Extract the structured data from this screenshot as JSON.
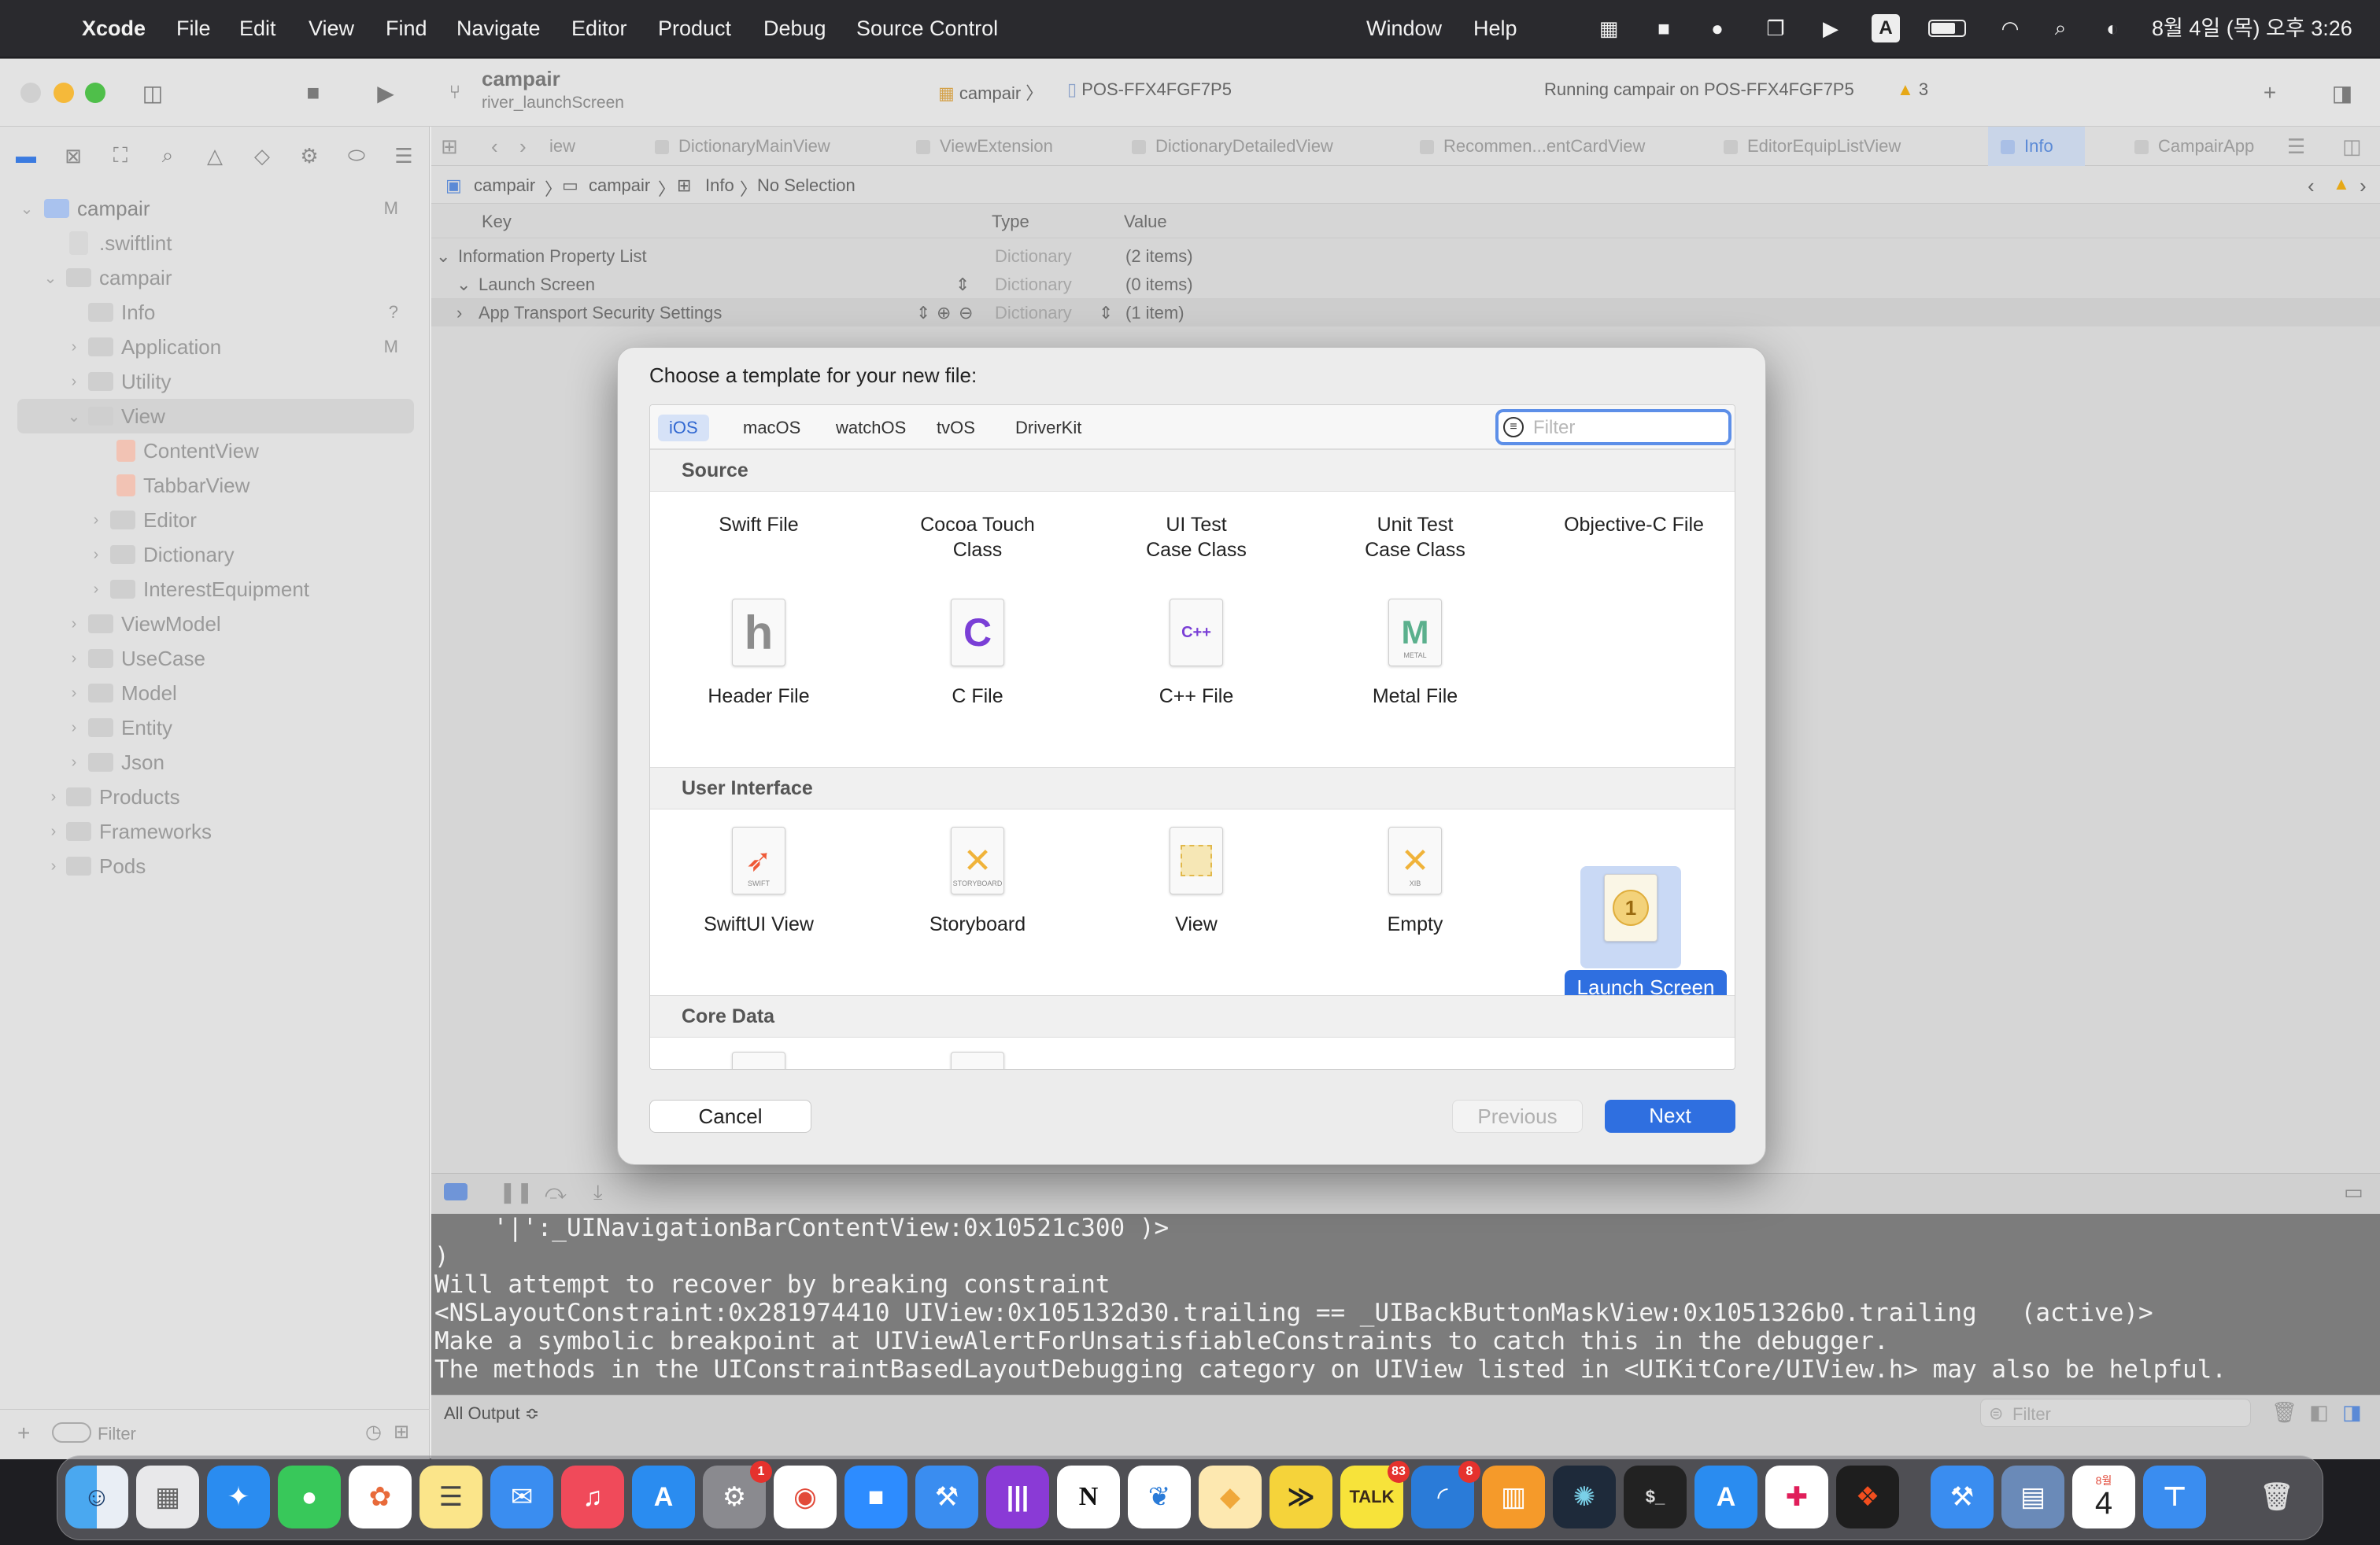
{
  "menubar": {
    "app": "Xcode",
    "items": [
      "File",
      "Edit",
      "View",
      "Find",
      "Navigate",
      "Editor",
      "Product",
      "Debug",
      "Source Control"
    ],
    "right_items": [
      "Window",
      "Help"
    ],
    "clock": "8월 4일 (목) 오후 3:26"
  },
  "toolbar": {
    "project": "campair",
    "branch": "river_launchScreen",
    "scheme": "campair",
    "device": "POS-FFX4FGF7P5",
    "status": "Running campair on POS-FFX4FGF7P5",
    "warnings": "3"
  },
  "sidebar": {
    "items": [
      {
        "label": "campair",
        "badge": "M"
      },
      {
        "label": ".swiftlint",
        "badge": ""
      },
      {
        "label": "campair",
        "badge": ""
      },
      {
        "label": "Info",
        "badge": "?"
      },
      {
        "label": "Application",
        "badge": "M"
      },
      {
        "label": "Utility",
        "badge": ""
      },
      {
        "label": "View",
        "badge": ""
      },
      {
        "label": "ContentView",
        "badge": ""
      },
      {
        "label": "TabbarView",
        "badge": ""
      },
      {
        "label": "Editor",
        "badge": ""
      },
      {
        "label": "Dictionary",
        "badge": ""
      },
      {
        "label": "InterestEquipment",
        "badge": ""
      },
      {
        "label": "ViewModel",
        "badge": ""
      },
      {
        "label": "UseCase",
        "badge": ""
      },
      {
        "label": "Model",
        "badge": ""
      },
      {
        "label": "Entity",
        "badge": ""
      },
      {
        "label": "Json",
        "badge": ""
      },
      {
        "label": "Products",
        "badge": ""
      },
      {
        "label": "Frameworks",
        "badge": ""
      },
      {
        "label": "Pods",
        "badge": ""
      }
    ],
    "filter_placeholder": "Filter"
  },
  "tabs": [
    "iew",
    "DictionaryMainView",
    "ViewExtension",
    "DictionaryDetailedView",
    "Recommen...entCardView",
    "EditorEquipListView",
    "Info",
    "CampairApp"
  ],
  "breadcrumb": [
    "campair",
    "campair",
    "Info",
    "No Selection"
  ],
  "plist": {
    "headers": {
      "key": "Key",
      "type": "Type",
      "value": "Value"
    },
    "rows": [
      {
        "key": "Information Property List",
        "type": "Dictionary",
        "value": "(2 items)"
      },
      {
        "key": "Launch Screen",
        "type": "Dictionary",
        "value": "(0 items)"
      },
      {
        "key": "App Transport Security Settings",
        "type": "Dictionary",
        "value": "(1 item)"
      }
    ]
  },
  "console": {
    "lines": [
      "    '|':_UINavigationBarContentView:0x10521c300 )>",
      ")",
      "",
      "Will attempt to recover by breaking constraint",
      "<NSLayoutConstraint:0x281974410 UIView:0x105132d30.trailing == _UIBackButtonMaskView:0x1051326b0.trailing   (active)>",
      "",
      "Make a symbolic breakpoint at UIViewAlertForUnsatisfiableConstraints to catch this in the debugger.",
      "The methods in the UIConstraintBasedLayoutDebugging category on UIView listed in <UIKitCore/UIView.h> may also be helpful."
    ],
    "output_selector": "All Output ≎",
    "filter_placeholder": "Filter"
  },
  "modal": {
    "title": "Choose a template for your new file:",
    "platforms": [
      "iOS",
      "macOS",
      "watchOS",
      "tvOS",
      "DriverKit"
    ],
    "selected_platform": "iOS",
    "filter_placeholder": "Filter",
    "sections": [
      "Source",
      "User Interface",
      "Core Data"
    ],
    "source_row1": [
      "Swift File",
      "Cocoa Touch\nClass",
      "UI Test\nCase Class",
      "Unit Test\nCase Class",
      "Objective-C File"
    ],
    "source_row2": [
      "Header File",
      "C File",
      "C++ File",
      "Metal File"
    ],
    "ui_row": [
      "SwiftUI View",
      "Storyboard",
      "View",
      "Empty",
      "Launch Screen"
    ],
    "selected_template": "Launch Screen",
    "icon_glyphs": {
      "header": "h",
      "c": "C",
      "cpp": "C++",
      "swift_tag": "SWIFT",
      "metal_tag": "METAL",
      "storyboard_tag": "STORYBOARD",
      "xib_tag": "XIB",
      "launch_glyph": "1"
    },
    "buttons": {
      "cancel": "Cancel",
      "previous": "Previous",
      "next": "Next"
    }
  },
  "dock": {
    "badges": {
      "settings": "1",
      "kakaotalk": "83",
      "reader": "8"
    },
    "calendar": {
      "month": "8월",
      "day": "4"
    }
  },
  "colors": {
    "accent": "#2f6fe0",
    "selection_bg": "#c9d9f5"
  }
}
